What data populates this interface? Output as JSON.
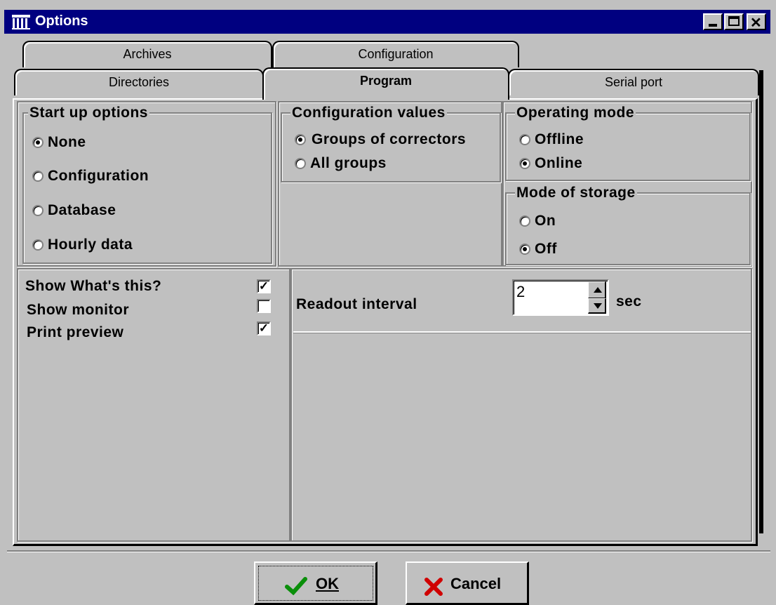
{
  "window": {
    "title": "Options"
  },
  "tabs": {
    "back": [
      {
        "label": "Archives"
      },
      {
        "label": "Configuration"
      }
    ],
    "front": [
      {
        "label": "Directories"
      },
      {
        "label": "Program"
      },
      {
        "label": "Serial port"
      }
    ],
    "active": "Program"
  },
  "startup": {
    "title": "Start up options",
    "options": [
      {
        "label": "None",
        "checked": true
      },
      {
        "label": "Configuration",
        "checked": false
      },
      {
        "label": "Database",
        "checked": false
      },
      {
        "label": "Hourly data",
        "checked": false
      }
    ]
  },
  "config_values": {
    "title": "Configuration values",
    "options": [
      {
        "label": "Groups of correctors",
        "checked": true
      },
      {
        "label": "All groups",
        "checked": false
      }
    ]
  },
  "operating_mode": {
    "title": "Operating mode",
    "options": [
      {
        "label": "Offline",
        "checked": false
      },
      {
        "label": "Online",
        "checked": true
      }
    ]
  },
  "storage_mode": {
    "title": "Mode of storage",
    "options": [
      {
        "label": "On",
        "checked": false
      },
      {
        "label": "Off",
        "checked": true
      }
    ]
  },
  "checkboxes": [
    {
      "label": "Show What's this?",
      "checked": true
    },
    {
      "label": "Show monitor",
      "checked": false
    },
    {
      "label": "Print preview",
      "checked": true
    }
  ],
  "readout": {
    "label": "Readout interval",
    "value": "2",
    "unit": "sec"
  },
  "buttons": {
    "ok": "OK",
    "cancel": "Cancel"
  }
}
